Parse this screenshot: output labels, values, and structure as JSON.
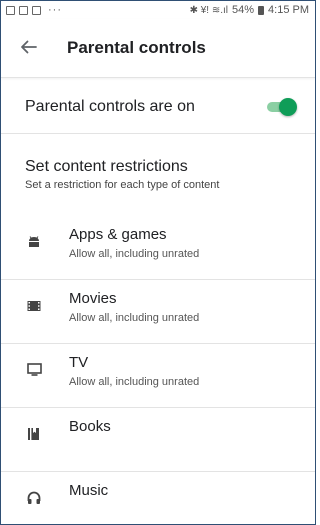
{
  "status_bar": {
    "left_icons": [
      "notification-icon",
      "mail-icon",
      "image-icon"
    ],
    "dots": "···",
    "right_glyphs": "✱ ¥! ≋.ıl",
    "battery": "54%",
    "time": "4:15 PM"
  },
  "app_bar": {
    "back_icon": "arrow-left-icon",
    "title": "Parental controls"
  },
  "toggle": {
    "label": "Parental controls are on",
    "on": true,
    "accent": "#0f9d58"
  },
  "section": {
    "title": "Set content restrictions",
    "subtitle": "Set a restriction for each type of content"
  },
  "items": [
    {
      "label": "Apps & games",
      "sub": "Allow all, including unrated",
      "icon": "android-icon"
    },
    {
      "label": "Movies",
      "sub": "Allow all, including unrated",
      "icon": "film-icon"
    },
    {
      "label": "TV",
      "sub": "Allow all, including unrated",
      "icon": "tv-icon"
    },
    {
      "label": "Books",
      "sub": "",
      "icon": "book-icon"
    },
    {
      "label": "Music",
      "sub": "",
      "icon": "headphones-icon"
    }
  ]
}
